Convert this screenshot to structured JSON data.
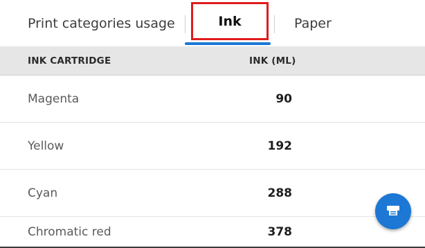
{
  "tabs": [
    {
      "label": "Print categories usage",
      "selected": false
    },
    {
      "label": "Ink",
      "selected": true
    },
    {
      "label": "Paper",
      "selected": false
    }
  ],
  "table": {
    "headers": {
      "cartridge": "INK CARTRIDGE",
      "ink": "INK (ML)"
    },
    "rows": [
      {
        "name": "Magenta",
        "value": "90"
      },
      {
        "name": "Yellow",
        "value": "192"
      },
      {
        "name": "Cyan",
        "value": "288"
      },
      {
        "name": "Chromatic red",
        "value": "378"
      }
    ]
  },
  "fab": {
    "icon": "printer-icon"
  },
  "colors": {
    "accent": "#1c78d4",
    "highlight_box": "#e11b1b",
    "header_bg": "#e6e6e6"
  }
}
